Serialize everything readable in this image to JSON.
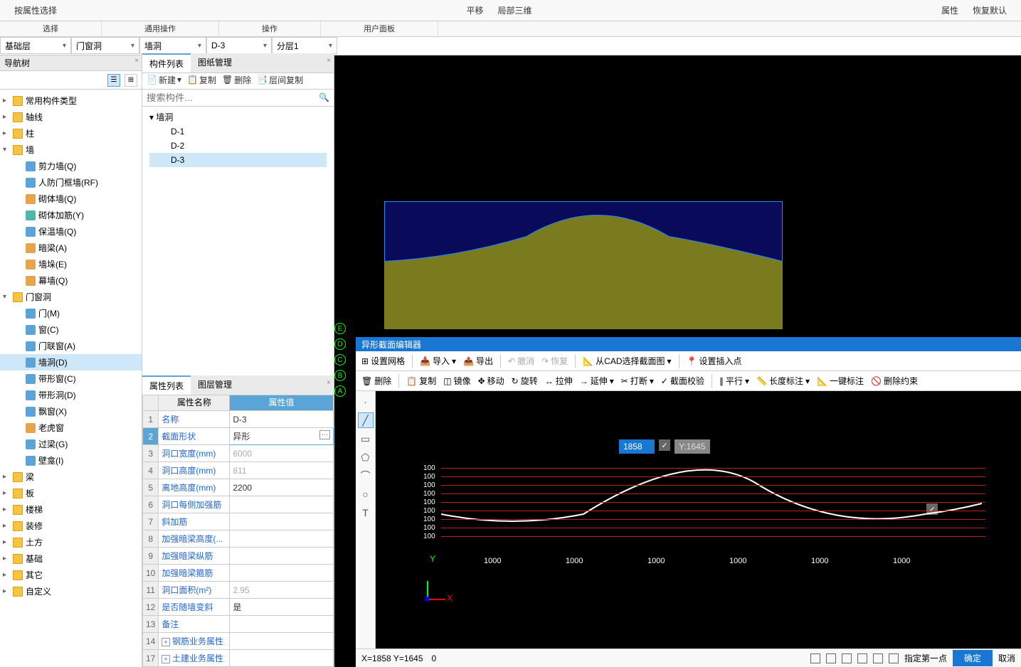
{
  "ribbon": {
    "buttons": [
      "按属性选择",
      "平移",
      "局部三维",
      "属性",
      "恢复默认"
    ],
    "groups": [
      "选择",
      "通用操作",
      "操作",
      "用户面板"
    ]
  },
  "dropdowns": [
    "基础层",
    "门窗洞",
    "墙洞",
    "D-3",
    "分层1"
  ],
  "nav": {
    "title": "导航树",
    "nodes": [
      {
        "l": 1,
        "t": "常用构件类型",
        "i": "folder"
      },
      {
        "l": 1,
        "t": "轴线",
        "i": "folder"
      },
      {
        "l": 1,
        "t": "柱",
        "i": "folder"
      },
      {
        "l": 1,
        "t": "墙",
        "i": "folder",
        "exp": true
      },
      {
        "l": 2,
        "t": "剪力墙(Q)",
        "i": "blue"
      },
      {
        "l": 2,
        "t": "人防门框墙(RF)",
        "i": "blue"
      },
      {
        "l": 2,
        "t": "砌体墙(Q)",
        "i": "orange"
      },
      {
        "l": 2,
        "t": "砌体加筋(Y)",
        "i": "teal"
      },
      {
        "l": 2,
        "t": "保温墙(Q)",
        "i": "blue"
      },
      {
        "l": 2,
        "t": "暗梁(A)",
        "i": "orange"
      },
      {
        "l": 2,
        "t": "墙垛(E)",
        "i": "orange"
      },
      {
        "l": 2,
        "t": "幕墙(Q)",
        "i": "orange"
      },
      {
        "l": 1,
        "t": "门窗洞",
        "i": "folder",
        "exp": true
      },
      {
        "l": 2,
        "t": "门(M)",
        "i": "blue"
      },
      {
        "l": 2,
        "t": "窗(C)",
        "i": "blue"
      },
      {
        "l": 2,
        "t": "门联窗(A)",
        "i": "blue"
      },
      {
        "l": 2,
        "t": "墙洞(D)",
        "i": "blue",
        "sel": true
      },
      {
        "l": 2,
        "t": "带形窗(C)",
        "i": "blue"
      },
      {
        "l": 2,
        "t": "带形洞(D)",
        "i": "blue"
      },
      {
        "l": 2,
        "t": "飘窗(X)",
        "i": "blue"
      },
      {
        "l": 2,
        "t": "老虎窗",
        "i": "orange"
      },
      {
        "l": 2,
        "t": "过梁(G)",
        "i": "blue"
      },
      {
        "l": 2,
        "t": "壁龛(I)",
        "i": "blue"
      },
      {
        "l": 1,
        "t": "梁",
        "i": "folder"
      },
      {
        "l": 1,
        "t": "板",
        "i": "folder"
      },
      {
        "l": 1,
        "t": "楼梯",
        "i": "folder"
      },
      {
        "l": 1,
        "t": "装修",
        "i": "folder"
      },
      {
        "l": 1,
        "t": "土方",
        "i": "folder"
      },
      {
        "l": 1,
        "t": "基础",
        "i": "folder"
      },
      {
        "l": 1,
        "t": "其它",
        "i": "folder"
      },
      {
        "l": 1,
        "t": "自定义",
        "i": "folder"
      }
    ]
  },
  "comp": {
    "tabs": [
      "构件列表",
      "图纸管理"
    ],
    "toolbar": [
      "新建",
      "复制",
      "删除",
      "层间复制"
    ],
    "search_ph": "搜索构件...",
    "group": "墙洞",
    "items": [
      "D-1",
      "D-2",
      "D-3"
    ],
    "sel": "D-3"
  },
  "props": {
    "tabs": [
      "属性列表",
      "图层管理"
    ],
    "cols": [
      "属性名称",
      "属性值"
    ],
    "rows": [
      {
        "n": "1",
        "k": "名称",
        "v": "D-3"
      },
      {
        "n": "2",
        "k": "截面形状",
        "v": "异形",
        "sel": true,
        "btn": true
      },
      {
        "n": "3",
        "k": "洞口宽度(mm)",
        "v": "6000",
        "dim": true
      },
      {
        "n": "4",
        "k": "洞口高度(mm)",
        "v": "811",
        "dim": true
      },
      {
        "n": "5",
        "k": "离地高度(mm)",
        "v": "2200"
      },
      {
        "n": "6",
        "k": "洞口每侧加强筋",
        "v": ""
      },
      {
        "n": "7",
        "k": "斜加筋",
        "v": ""
      },
      {
        "n": "8",
        "k": "加强暗梁高度(...",
        "v": ""
      },
      {
        "n": "9",
        "k": "加强暗梁纵筋",
        "v": ""
      },
      {
        "n": "10",
        "k": "加强暗梁箍筋",
        "v": ""
      },
      {
        "n": "11",
        "k": "洞口面积(m²)",
        "v": "2.95",
        "dim": true
      },
      {
        "n": "12",
        "k": "是否随墙变斜",
        "v": "是"
      },
      {
        "n": "13",
        "k": "备注",
        "v": ""
      },
      {
        "n": "14",
        "k": "钢筋业务属性",
        "v": "",
        "exp": "+"
      },
      {
        "n": "17",
        "k": "土建业务属性",
        "v": "",
        "exp": "+"
      }
    ]
  },
  "axis_labels": [
    "E",
    "D",
    "C",
    "B",
    "A"
  ],
  "editor": {
    "title": "异形截面编辑器",
    "tb1": [
      "设置网格",
      "导入",
      "导出",
      "撤消",
      "恢复",
      "从CAD选择截面图",
      "设置插入点"
    ],
    "tb2": [
      "删除",
      "复制",
      "镜像",
      "移动",
      "旋转",
      "拉伸",
      "延伸",
      "打断",
      "截面校验",
      "平行",
      "长度标注",
      "一键标注",
      "删除约束"
    ],
    "coord": {
      "x": "1858",
      "y": "Y:1645"
    },
    "y_ticks": [
      "100",
      "100",
      "100",
      "100",
      "100",
      "100",
      "100",
      "100",
      "100"
    ],
    "x_ticks": [
      "1000",
      "1000",
      "1000",
      "1000",
      "1000",
      "1000"
    ]
  },
  "status": {
    "coord": "X=1858 Y=1645",
    "angle": "0",
    "prompt": "指定第一点",
    "ok": "确定",
    "cancel": "取消"
  }
}
